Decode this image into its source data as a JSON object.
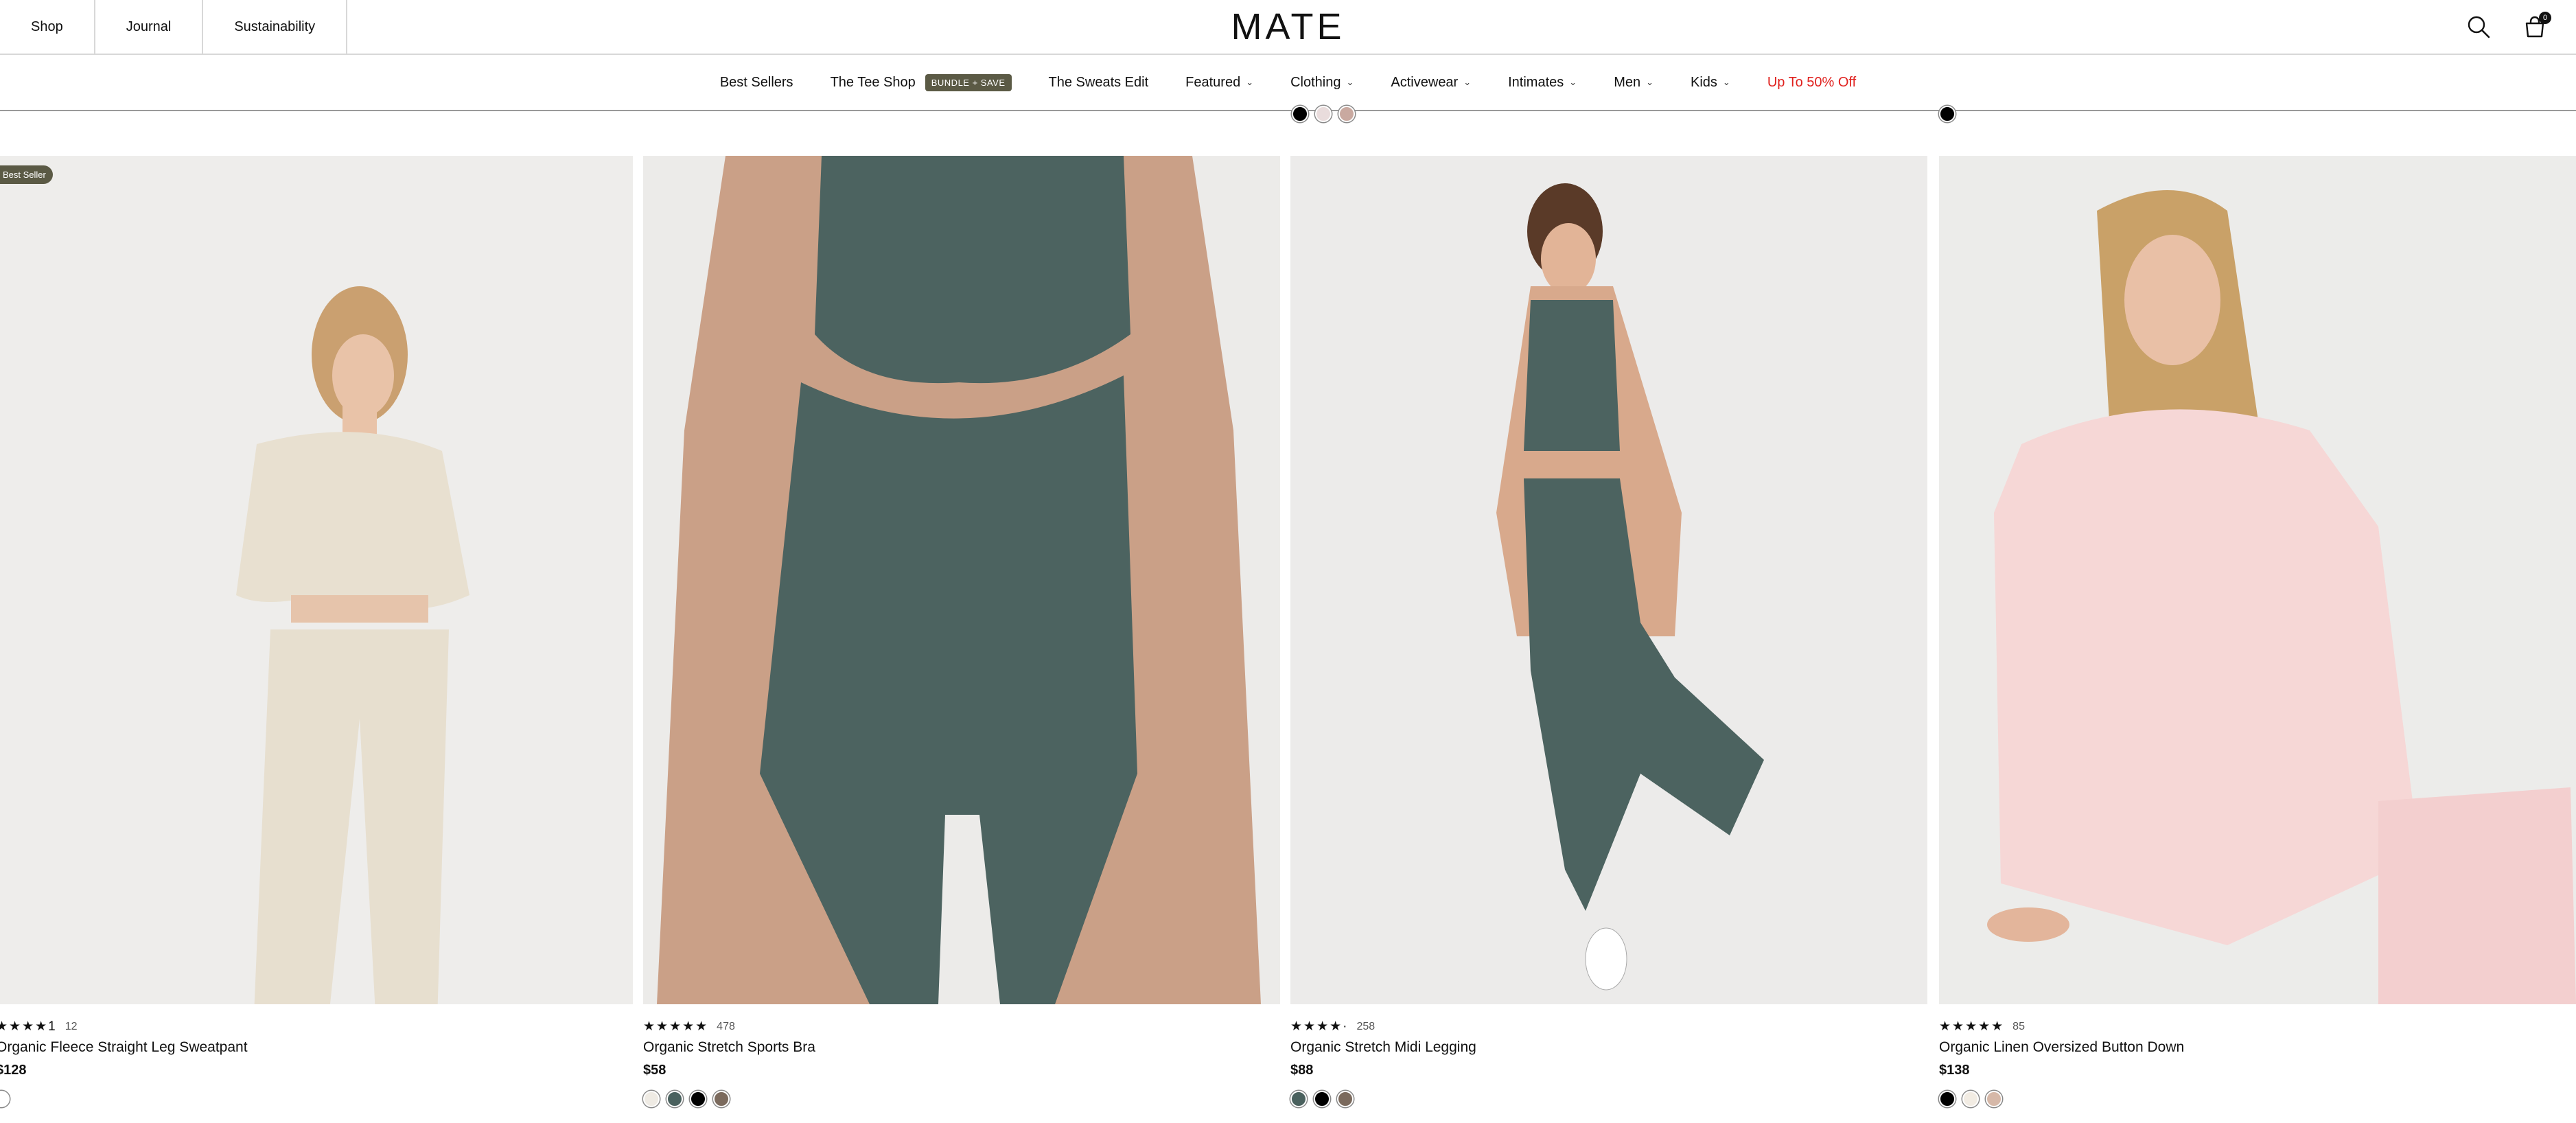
{
  "header": {
    "left_links": [
      "Shop",
      "Journal",
      "Sustainability"
    ],
    "logo": "MATE",
    "cart_count": "0",
    "icons": [
      "search-icon",
      "bag-icon"
    ]
  },
  "nav": {
    "items": [
      {
        "label": "Best Sellers",
        "dropdown": false
      },
      {
        "label": "The Tee Shop",
        "dropdown": false,
        "badge": "BUNDLE + SAVE"
      },
      {
        "label": "The Sweats Edit",
        "dropdown": false
      },
      {
        "label": "Featured",
        "dropdown": true
      },
      {
        "label": "Clothing",
        "dropdown": true
      },
      {
        "label": "Activewear",
        "dropdown": true
      },
      {
        "label": "Intimates",
        "dropdown": true
      },
      {
        "label": "Men",
        "dropdown": true
      },
      {
        "label": "Kids",
        "dropdown": true
      },
      {
        "label": "Up To 50% Off",
        "dropdown": false,
        "color": "#e0211e"
      }
    ]
  },
  "previous_row": {
    "swatches_a": [
      "#000000",
      "#e9dcdc",
      "#c9a9a0"
    ],
    "swatches_b": [
      "#000000"
    ]
  },
  "products": [
    {
      "badge": "Best Seller",
      "stars": "★★★★1",
      "reviews": "12",
      "name": "Organic Fleece Straight Leg Sweatpant",
      "price": "$128",
      "swatches": [
        "#ffffff"
      ]
    },
    {
      "badge": "",
      "stars": "★★★★★",
      "reviews": "478",
      "name": "Organic Stretch Sports Bra",
      "price": "$58",
      "swatches": [
        "#efebe4",
        "#4a615e",
        "#000000",
        "#7b6a5d"
      ]
    },
    {
      "badge": "",
      "stars": "★★★★·",
      "reviews": "258",
      "name": "Organic Stretch Midi Legging",
      "price": "$88",
      "swatches": [
        "#4a615e",
        "#000000",
        "#7b6a5d"
      ]
    },
    {
      "badge": "",
      "stars": "★★★★★",
      "reviews": "85",
      "name": "Organic Linen Oversized Button Down",
      "price": "$138",
      "swatches": [
        "#000000",
        "#f2ece3",
        "#d6b8a8"
      ]
    }
  ],
  "colors": {
    "accent_badge": "#5b5a45",
    "sale_red": "#e0211e",
    "image_bg": "#ededeb"
  }
}
